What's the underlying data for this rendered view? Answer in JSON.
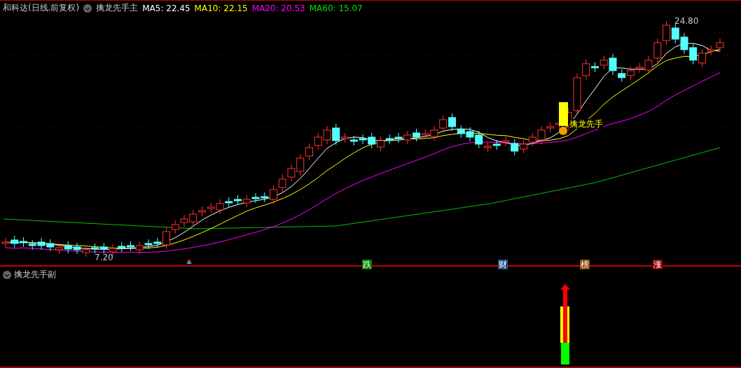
{
  "main_panel": {
    "stock_label": "和科达(日线.前复权)",
    "indicator": "擒龙先手主",
    "ma_readings": [
      {
        "label": "MA5: 22.45",
        "color": "#ffffff"
      },
      {
        "label": "MA10: 22.15",
        "color": "#ffff00"
      },
      {
        "label": "MA20: 20.53",
        "color": "#ff00ff"
      },
      {
        "label": "MA60: 15.07",
        "color": "#00e000"
      }
    ],
    "high_label": "24.80",
    "low_label": "7.20",
    "signal_label": "擒龙先手",
    "event_tags": [
      {
        "text": "跌",
        "color": "#008000"
      },
      {
        "text": "财",
        "color": "#1f4e8c"
      },
      {
        "text": "榜",
        "color": "#8b4a0a"
      },
      {
        "text": "涨",
        "color": "#8b0000"
      }
    ]
  },
  "sub_panel": {
    "indicator": "擒龙先手副"
  }
}
